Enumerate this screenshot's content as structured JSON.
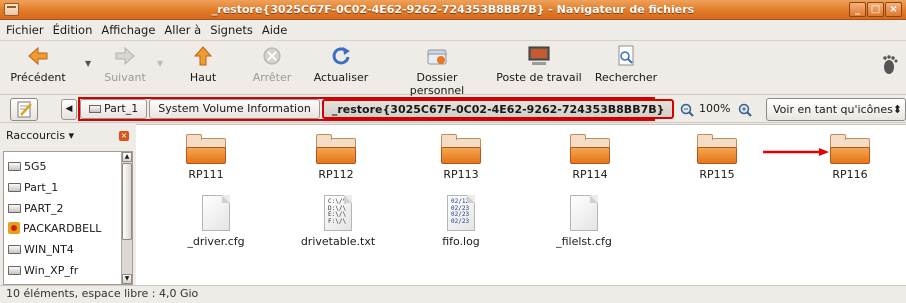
{
  "window": {
    "title": "_restore{3025C67F-0C02-4E62-9262-724353B8BB7B} - Navigateur de fichiers",
    "minimize": "_",
    "maximize": "□",
    "close": "×"
  },
  "menu": [
    "Fichier",
    "Édition",
    "Affichage",
    "Aller à",
    "Signets",
    "Aide"
  ],
  "toolbar": {
    "back": "Précédent",
    "forward": "Suivant",
    "up": "Haut",
    "stop": "Arrêter",
    "reload": "Actualiser",
    "home": "Dossier personnel",
    "computer": "Poste de travail",
    "search": "Rechercher"
  },
  "location": {
    "crumbs": [
      "Part_1",
      "System Volume Information",
      "_restore{3025C67F-0C02-4E62-9262-724353B8BB7B}"
    ],
    "zoom": "100%",
    "view": "Voir en tant qu'icônes"
  },
  "sidebar": {
    "title": "Raccourcis",
    "items": [
      "5G5",
      "Part_1",
      "PART_2",
      "PACKARDBELL",
      "WIN_NT4",
      "Win_XP_fr"
    ]
  },
  "files": {
    "folders": [
      "RP111",
      "RP112",
      "RP113",
      "RP114",
      "RP115",
      "RP116"
    ],
    "documents": [
      "_driver.cfg",
      "drivetable.txt",
      "fifo.log",
      "_filelst.cfg"
    ],
    "drivetable_preview": "C:\\/\\\nD:\\/\\\nE:\\/\\\nF:\\/\\",
    "fifo_preview": "02/12\n02/23\n02/23\n02/23"
  },
  "status": "10 éléments, espace libre : 4,0 Gio",
  "colors": {
    "titlebar": "#e07b2a",
    "highlight_border": "#d40000",
    "annotation_arrow": "#e00000"
  }
}
